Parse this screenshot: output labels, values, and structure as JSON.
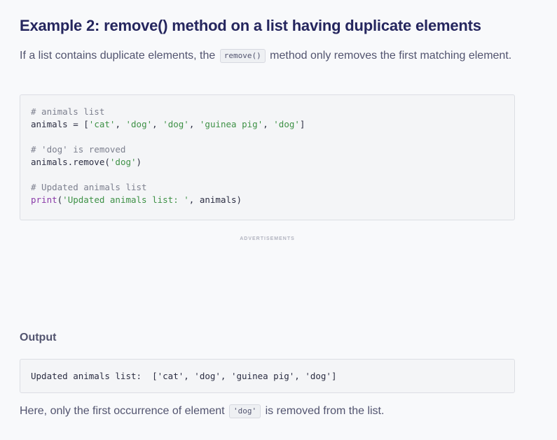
{
  "title": "Example 2: remove() method on a list having duplicate elements",
  "intro": {
    "before": "If a list contains duplicate elements, the",
    "code": "remove()",
    "after": "method only removes the first matching element."
  },
  "code_block": {
    "comment1": "# animals list",
    "line1_prefix": "animals = [",
    "s_cat": "'cat'",
    "s_dog": "'dog'",
    "s_guinea": "'guinea pig'",
    "sep": ", ",
    "close_bracket": "]",
    "comment2": "# 'dog' is removed",
    "remove_prefix": "animals.remove(",
    "remove_arg": "'dog'",
    "close_paren": ")",
    "comment3": "# Updated animals list",
    "print_kw": "print",
    "open_paren": "(",
    "print_str": "'Updated animals list: '",
    "print_rest": ", animals)"
  },
  "ads_label": "ADVERTISEMENTS",
  "output_heading": "Output",
  "output_text": "Updated animals list:  ['cat', 'dog', 'guinea pig', 'dog']",
  "outro": {
    "before": "Here, only the first occurrence of element",
    "code": "'dog'",
    "after": "is removed from the list."
  },
  "colors": {
    "title": "#25265e",
    "body_text": "#52546f",
    "code_bg": "#f4f5f7",
    "string": "#3e9146",
    "keyword": "#8a3aa8",
    "comment": "#7d808f"
  }
}
